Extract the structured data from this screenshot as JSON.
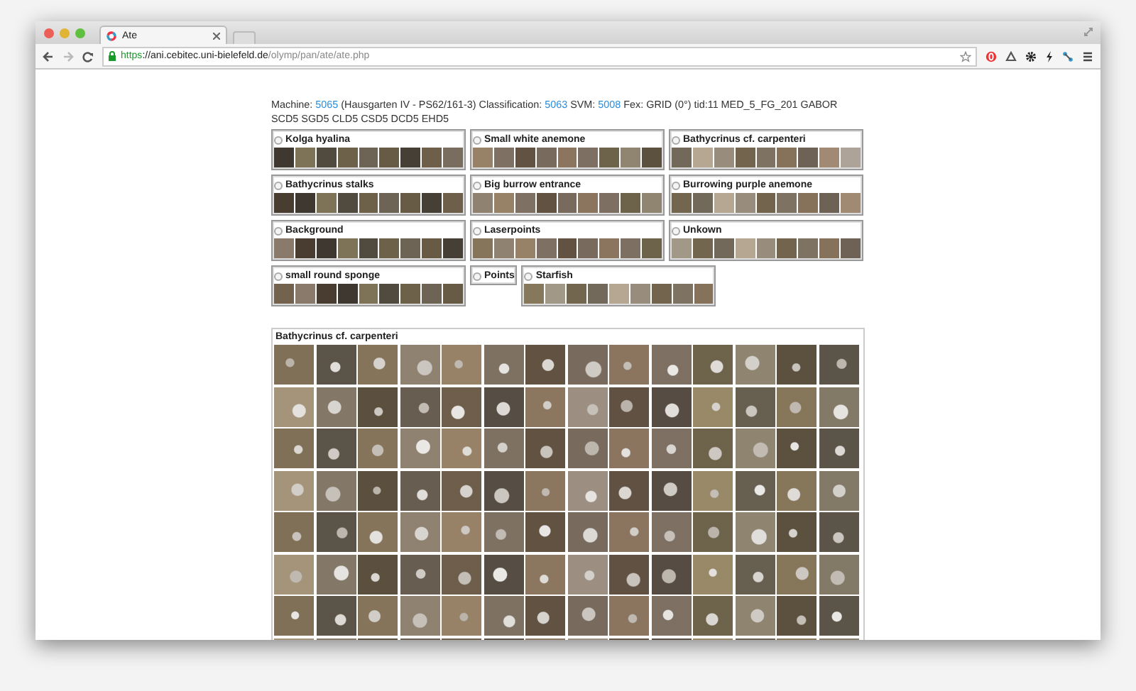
{
  "window": {
    "tab_title": "Ate",
    "url": {
      "scheme": "https",
      "host": "://ani.cebitec.uni-bielefeld.de",
      "path": "/olymp/pan/ate/ate.php"
    }
  },
  "info": [
    {
      "kind": "text",
      "text": "Machine: "
    },
    {
      "kind": "link",
      "text": "5065"
    },
    {
      "kind": "text",
      "text": " (Hausgarten IV - PS62/161-3) Classification: "
    },
    {
      "kind": "link",
      "text": "5063"
    },
    {
      "kind": "text",
      "text": " SVM: "
    },
    {
      "kind": "link",
      "text": "5008"
    },
    {
      "kind": "text",
      "text": " Fex: GRID (0°) tid:11 MED_5_FG_201 GABOR SCD5 SGD5 CLD5 CSD5 DCD5 EHD5"
    }
  ],
  "categories": [
    {
      "name": "Kolga hyalina",
      "selected": false,
      "kind": "samples"
    },
    {
      "name": "Small white anemone",
      "selected": false,
      "kind": "samples"
    },
    {
      "name": "Bathycrinus cf. carpenteri",
      "selected": false,
      "kind": "samples"
    },
    {
      "name": "Bathycrinus stalks",
      "selected": false,
      "kind": "samples"
    },
    {
      "name": "Big burrow entrance",
      "selected": false,
      "kind": "samples"
    },
    {
      "name": "Burrowing purple anemone",
      "selected": false,
      "kind": "samples"
    },
    {
      "name": "Background",
      "selected": false,
      "kind": "samples"
    },
    {
      "name": "Laserpoints",
      "selected": false,
      "kind": "samples"
    },
    {
      "name": "Unkown",
      "selected": false,
      "kind": "samples"
    },
    {
      "name": "small round sponge",
      "selected": false,
      "kind": "samples"
    },
    {
      "name": "Points",
      "selected": false,
      "kind": "label-only"
    },
    {
      "name": "Starfish",
      "selected": false,
      "kind": "samples"
    }
  ],
  "detail": {
    "title": "Bathycrinus cf. carpenteri"
  }
}
